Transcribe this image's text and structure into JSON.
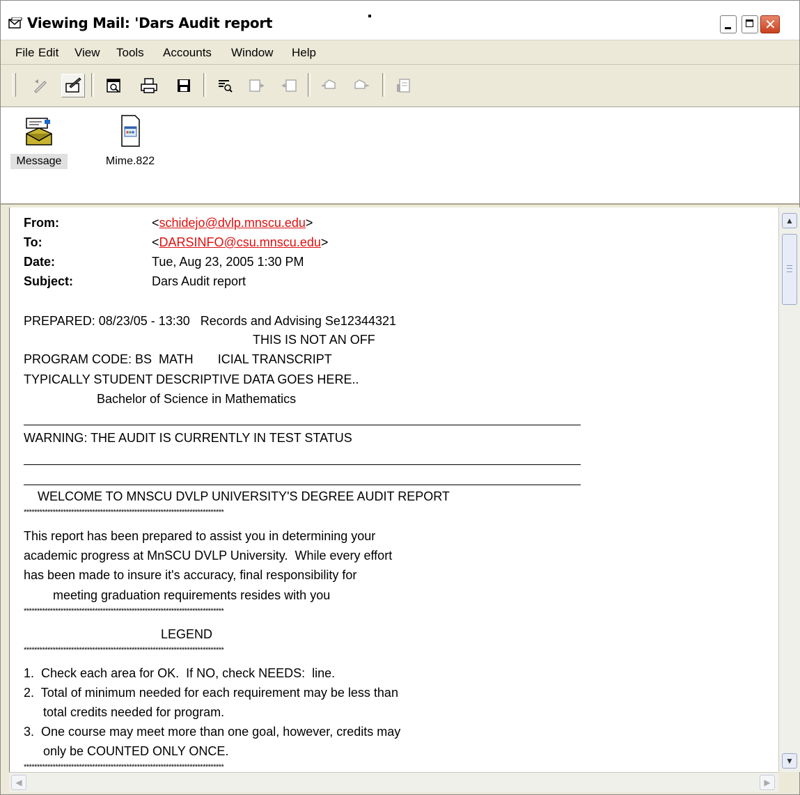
{
  "window": {
    "title": "Viewing  Mail: 'Dars Audit report"
  },
  "menu": {
    "items": [
      "File",
      "Edit",
      "View",
      "Tools",
      "Accounts",
      "Window",
      "Help"
    ]
  },
  "toolbar": {
    "buttons": [
      "reply-tool-icon",
      "edit-pencil-icon",
      "preview-icon",
      "print-icon",
      "save-icon",
      "find-icon",
      "next-icon",
      "previous-icon",
      "forward-icon",
      "reply-all-icon",
      "properties-icon"
    ]
  },
  "attachments": [
    {
      "label": "Message",
      "icon": "message-envelope-icon",
      "selected": true
    },
    {
      "label": "Mime.822",
      "icon": "mime-document-icon",
      "selected": false
    }
  ],
  "header": {
    "from_label": "From:",
    "from_value": "schidejo@dvlp.mnscu.edu",
    "to_label": "To:",
    "to_value": "DARSINFO@csu.mnscu.edu",
    "date_label": "Date:",
    "date_value": "Tue, Aug 23, 2005  1:30 PM",
    "subject_label": "Subject:",
    "subject_value": "Dars Audit report"
  },
  "body": {
    "prepared": "PREPARED: 08/23/05 - 13:30   Records and Advising Se12344321",
    "not_an_off": "THIS IS NOT AN OFF",
    "program_code": "PROGRAM CODE: BS  MATH       ICIAL TRANSCRIPT",
    "typically": "TYPICALLY STUDENT DESCRIPTIVE DATA GOES HERE..",
    "degree": "Bachelor of Science in Mathematics",
    "warning": "WARNING: THE AUDIT IS CURRENTLY IN TEST STATUS",
    "welcome": "WELCOME TO MNSCU DVLP UNIVERSITY'S DEGREE AUDIT REPORT",
    "stars": "****************************************************************************",
    "p1": "This report has been prepared to assist you in determining your",
    "p2": "academic progress at MnSCU DVLP University.  While every effort",
    "p3": "has been made to insure it's accuracy, final responsibility for",
    "p4": "meeting graduation requirements resides with you",
    "legend": "LEGEND",
    "l1": "1.  Check each area for OK.  If NO, check NEEDS:  line.",
    "l2": "2.  Total of minimum needed for each requirement may be less than",
    "l2b": "total credits needed for program.",
    "l3": "3.  One course may meet more than one goal, however, credits may",
    "l3b": "only be COUNTED ONLY ONCE."
  }
}
